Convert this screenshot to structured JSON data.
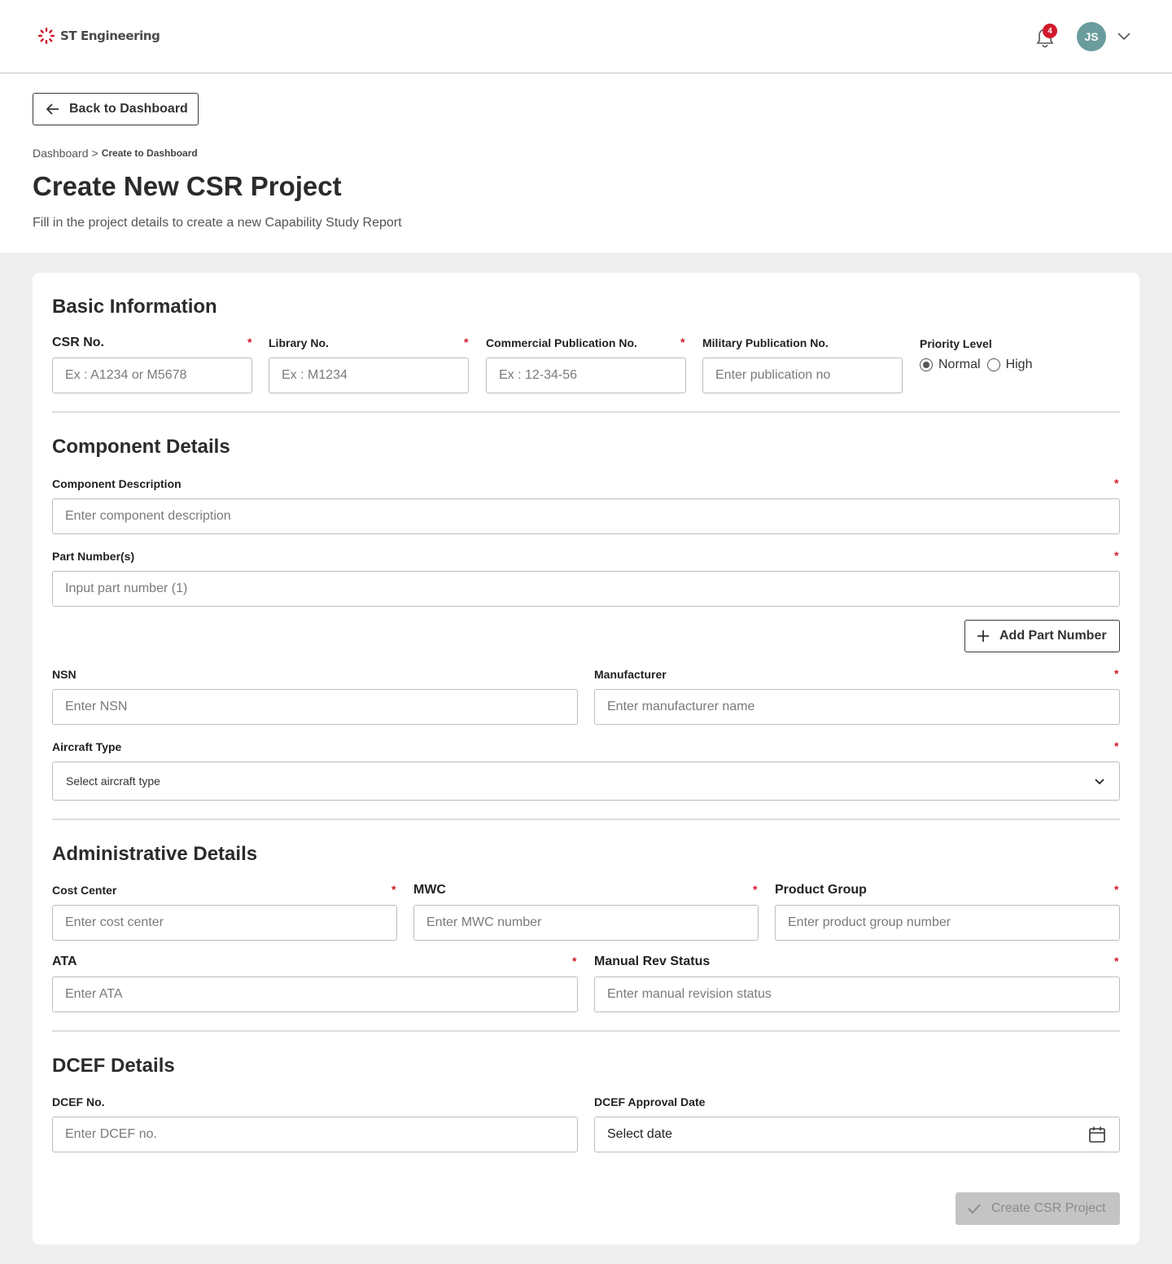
{
  "header": {
    "brand": "ST Engineering",
    "notification_count": "4",
    "user_initials": "JS"
  },
  "nav": {
    "back_label": "Back to Dashboard",
    "breadcrumb_root": "Dashboard",
    "breadcrumb_sep": ">",
    "breadcrumb_current": "Create to Dashboard"
  },
  "page": {
    "title": "Create New CSR Project",
    "subtitle": "Fill in the project details to create a new Capability Study Report"
  },
  "basic": {
    "title": "Basic Information",
    "csr_label": "CSR No.",
    "csr_placeholder": "Ex : A1234 or M5678",
    "library_label": "Library No.",
    "library_placeholder": "Ex : M1234",
    "commercial_label": "Commercial Publication No.",
    "commercial_placeholder": "Ex : 12-34-56",
    "military_label": "Military Publication No.",
    "military_placeholder": "Enter publication no",
    "priority_label": "Priority Level",
    "priority_options": [
      "Normal",
      "High"
    ],
    "priority_selected": "Normal"
  },
  "component": {
    "title": "Component Details",
    "description_label": "Component Description",
    "description_placeholder": "Enter component description",
    "part_label": "Part Number(s)",
    "part_placeholder": "Input part number (1)",
    "add_part_label": "Add Part Number",
    "nsn_label": "NSN",
    "nsn_placeholder": "Enter NSN",
    "manufacturer_label": "Manufacturer",
    "manufacturer_placeholder": "Enter manufacturer name",
    "aircraft_label": "Aircraft Type",
    "aircraft_value": "Select aircraft type"
  },
  "admin": {
    "title": "Administrative Details",
    "cost_label": "Cost Center",
    "cost_placeholder": "Enter cost center",
    "mwc_label": "MWC",
    "mwc_placeholder": "Enter MWC number",
    "product_label": "Product Group",
    "product_placeholder": "Enter product group number",
    "ata_label": "ATA",
    "ata_placeholder": "Enter ATA",
    "manual_label": "Manual Rev Status",
    "manual_placeholder": "Enter manual revision status"
  },
  "dcef": {
    "title": "DCEF Details",
    "no_label": "DCEF No.",
    "no_placeholder": "Enter DCEF no.",
    "date_label": "DCEF Approval Date",
    "date_value": "Select date"
  },
  "actions": {
    "submit_label": "Create CSR Project"
  },
  "required_mark": "*",
  "colors": {
    "accent_red": "#d1192c",
    "avatar": "#6a9c9d",
    "disabled_button": "#c4c4c4"
  }
}
